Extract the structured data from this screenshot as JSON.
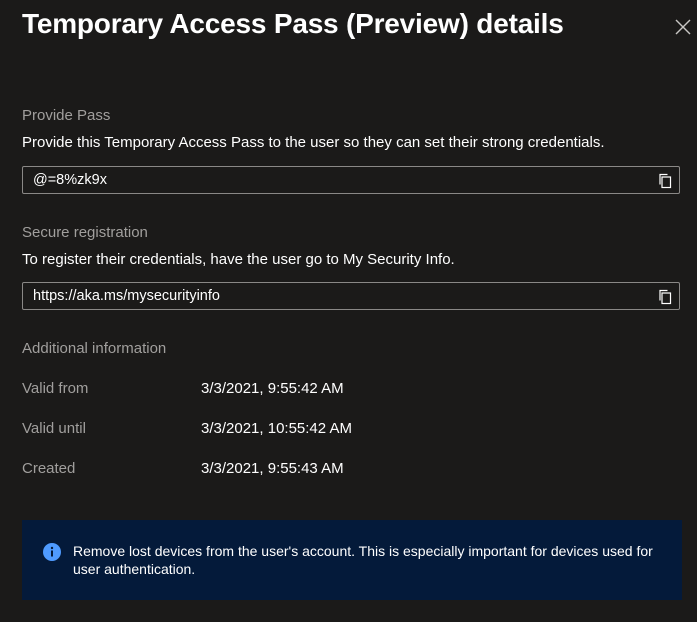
{
  "header": {
    "title": "Temporary Access Pass (Preview) details",
    "close_icon": "close-icon"
  },
  "provide_pass": {
    "label": "Provide Pass",
    "description": "Provide this Temporary Access Pass to the user so they can set their strong credentials.",
    "value": "@=8%zk9x",
    "copy_icon": "copy-icon"
  },
  "secure_registration": {
    "label": "Secure registration",
    "description": "To register their credentials, have the user go to My Security Info.",
    "value": "https://aka.ms/mysecurityinfo",
    "copy_icon": "copy-icon"
  },
  "additional_info": {
    "label": "Additional information",
    "rows": [
      {
        "label": "Valid from",
        "value": "3/3/2021, 9:55:42 AM"
      },
      {
        "label": "Valid until",
        "value": "3/3/2021, 10:55:42 AM"
      },
      {
        "label": "Created",
        "value": "3/3/2021, 9:55:43 AM"
      }
    ]
  },
  "banner": {
    "icon": "info-icon",
    "text": "Remove lost devices from the user's account. This is especially important for devices used for user authentication."
  },
  "colors": {
    "background": "#1b1a19",
    "muted_text": "#a19f9d",
    "field_border": "#8a8886",
    "banner_background": "#041a3a",
    "info_icon": "#4f9bff"
  }
}
